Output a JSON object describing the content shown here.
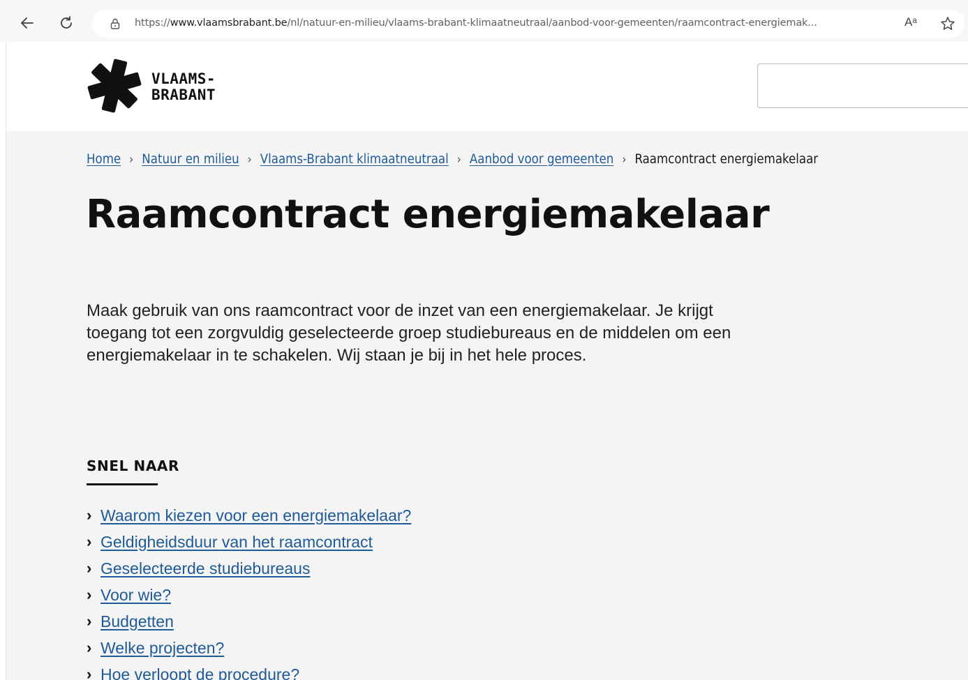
{
  "browser": {
    "url_prefix": "https://",
    "url_host": "www.vlaamsbrabant.be",
    "url_path": "/nl/natuur-en-milieu/vlaams-brabant-klimaatneutraal/aanbod-voor-gemeenten/raamcontract-energiemak...",
    "read_aloud_label": "Aᵃ"
  },
  "header": {
    "logo_line1": "VLAAMS-",
    "logo_line2": "BRABANT",
    "search_value": ""
  },
  "breadcrumb": {
    "items": [
      "Home",
      "Natuur en milieu",
      "Vlaams-Brabant klimaatneutraal",
      "Aanbod voor gemeenten"
    ],
    "separator": "›",
    "current": "Raamcontract energiemakelaar"
  },
  "page": {
    "title": "Raamcontract energiemakelaar",
    "intro": "Maak gebruik van ons raamcontract voor de inzet van een energiemakelaar. Je krijgt toegang tot een zorgvuldig geselecteerde groep studiebureaus en de middelen om een energiemakelaar in te schakelen. Wij staan je bij in het hele proces."
  },
  "snel_naar": {
    "heading": "SNEL NAAR",
    "chevron": "›",
    "links": [
      "Waarom kiezen voor een energiemakelaar?",
      "Geldigheidsduur van het raamcontract",
      "Geselecteerde studiebureaus",
      "Voor wie?",
      "Budgetten",
      "Welke projecten?",
      "Hoe verloopt de procedure?"
    ]
  },
  "icons": {
    "back": "arrow-left-icon",
    "reload": "reload-icon",
    "lock": "lock-icon",
    "favorite": "star-icon",
    "logo": "asterisk-logo-icon"
  }
}
